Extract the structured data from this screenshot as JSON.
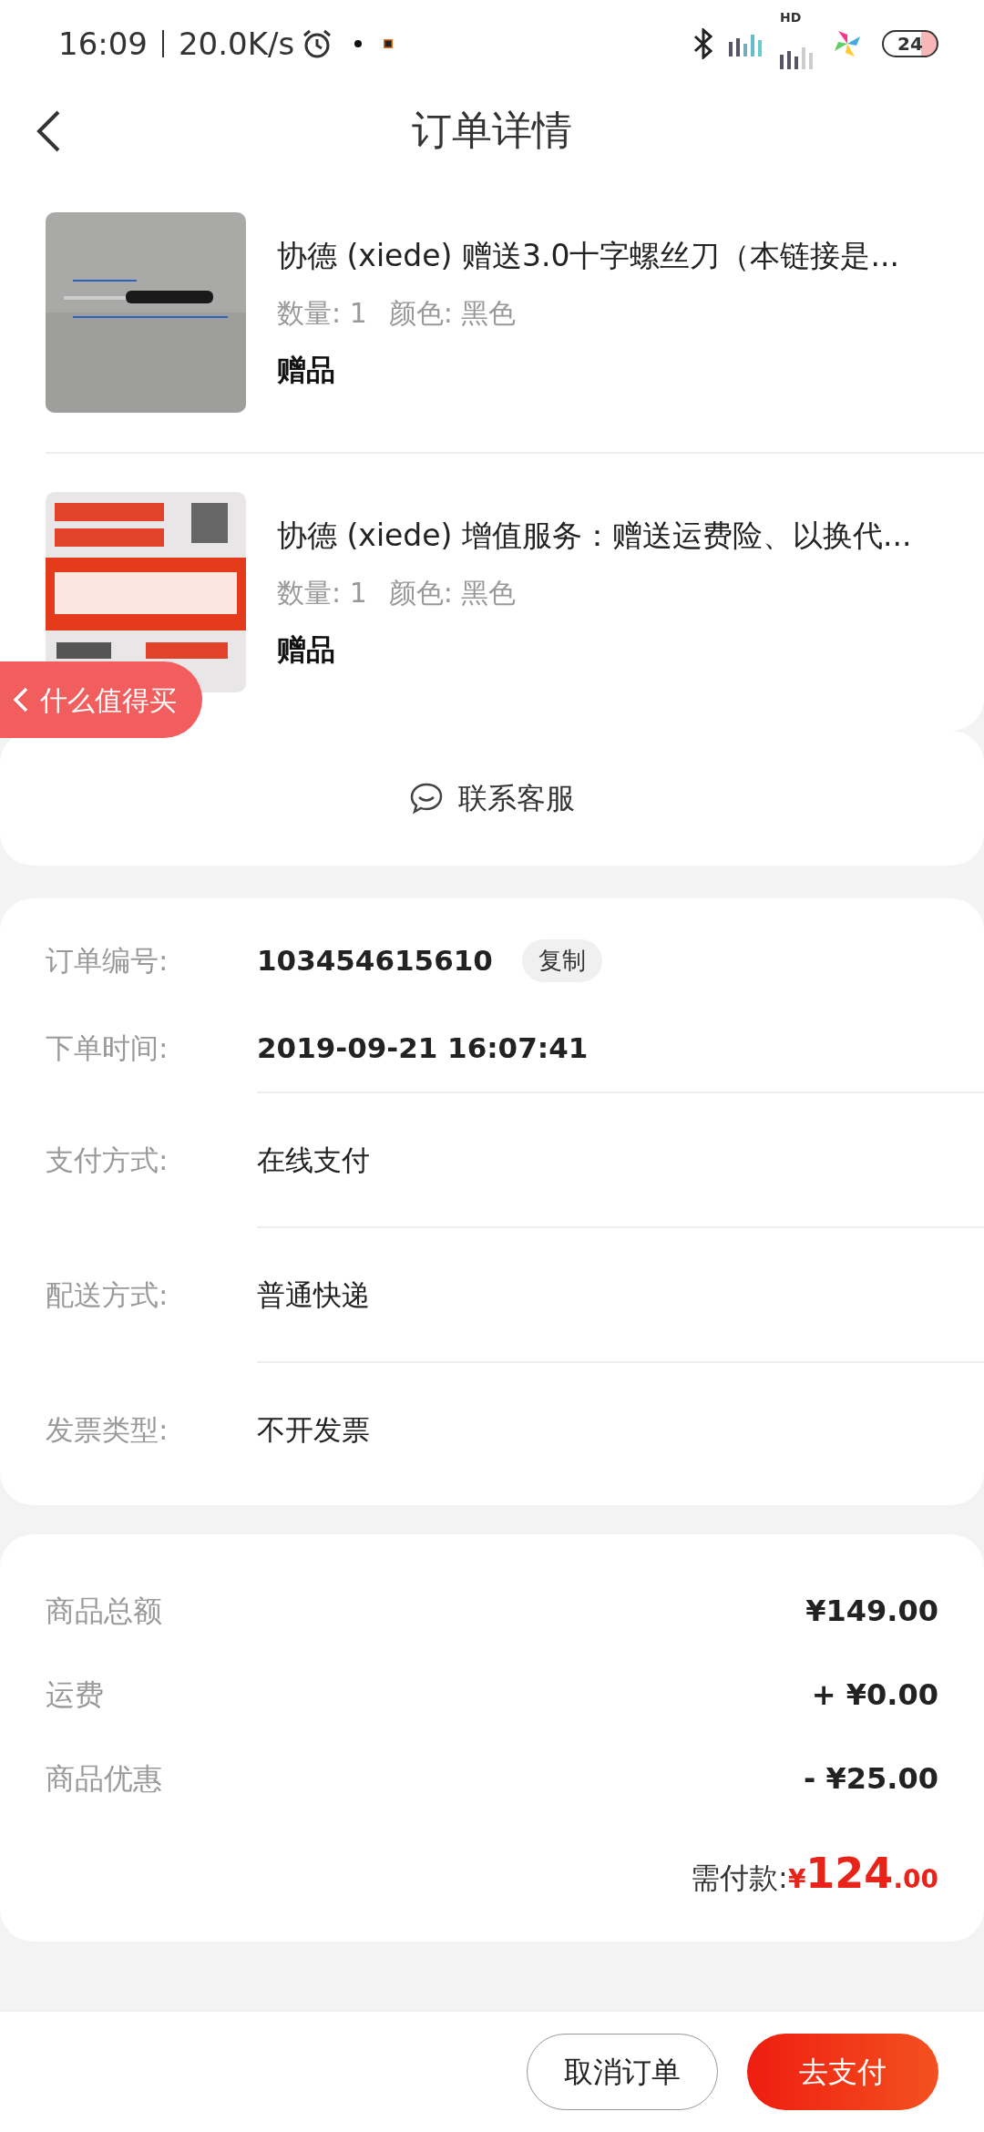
{
  "status_bar": {
    "time": "16:09",
    "network_speed": "20.0K/s",
    "signal_label": "HD",
    "battery": "24"
  },
  "header": {
    "title": "订单详情"
  },
  "products": [
    {
      "title": "协德 (xiede) 赠送3.0十字螺丝刀（本链接是...",
      "quantity": "数量: 1",
      "variant": "颜色: 黑色",
      "tag": "赠品"
    },
    {
      "title": "协德 (xiede) 增值服务：赠送运费险、以换代...",
      "quantity": "数量: 1",
      "variant": "颜色: 黑色",
      "tag": "赠品"
    }
  ],
  "floating_button": {
    "label": "什么值得买"
  },
  "contact": {
    "label": "联系客服"
  },
  "order_info": [
    {
      "label": "订单编号:",
      "value": "103454615610",
      "kind": "number",
      "action": "复制"
    },
    {
      "label": "下单时间:",
      "value": "2019-09-21 16:07:41",
      "kind": "number"
    },
    {
      "label": "支付方式:",
      "value": "在线支付",
      "kind": "text"
    },
    {
      "label": "配送方式:",
      "value": "普通快递",
      "kind": "text"
    },
    {
      "label": "发票类型:",
      "value": "不开发票",
      "kind": "text"
    }
  ],
  "price_rows": [
    {
      "label": "商品总额",
      "value": "¥149.00"
    },
    {
      "label": "运费",
      "value": "+ ¥0.00"
    },
    {
      "label": "商品优惠",
      "value": "- ¥25.00"
    }
  ],
  "total": {
    "label": "需付款:",
    "currency": "¥",
    "integer": "124",
    "decimals": ".00"
  },
  "buttons": [
    {
      "label": "取消订单",
      "kind": "secondary"
    },
    {
      "label": "去支付",
      "kind": "primary"
    }
  ]
}
